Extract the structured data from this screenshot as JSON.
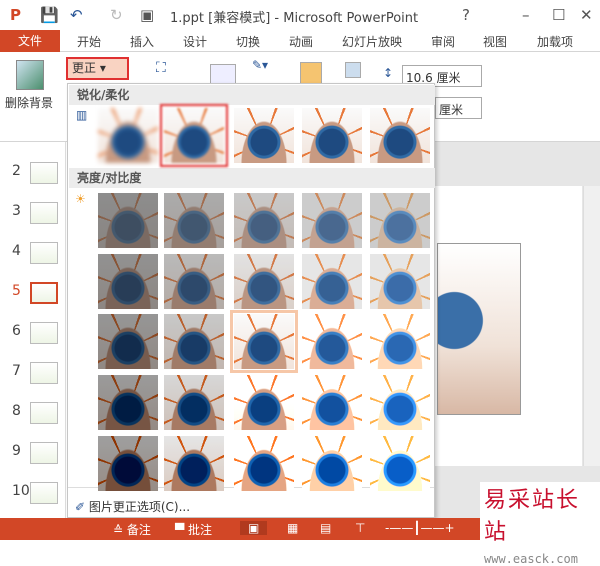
{
  "titlebar": {
    "title": "1.ppt [兼容模式] - Microsoft PowerPoint",
    "help": "?",
    "minimize": "–",
    "maximize": "☐",
    "close": "✕"
  },
  "tabs": {
    "file": "文件",
    "items": [
      "开始",
      "插入",
      "设计",
      "切换",
      "动画",
      "幻灯片放映",
      "审阅",
      "视图",
      "加载项"
    ]
  },
  "ribbon": {
    "remove_bg": "删除背景",
    "corrections": "更正 ▾",
    "height": "10.6 厘米",
    "width_unit": "厘米"
  },
  "menu": {
    "sharpen_header": "锐化/柔化",
    "brightness_header": "亮度/对比度",
    "options": "图片更正选项(C)..."
  },
  "slides": [
    "2",
    "3",
    "4",
    "5",
    "6",
    "7",
    "8",
    "9",
    "10"
  ],
  "active_slide": "5",
  "status": {
    "notes": "≙ 备注",
    "comments": "▀ 批注"
  },
  "watermark": {
    "name": "易采站长站",
    "url": "www.easck.com"
  },
  "colors": {
    "accent": "#d24726",
    "selection": "#e03030"
  }
}
